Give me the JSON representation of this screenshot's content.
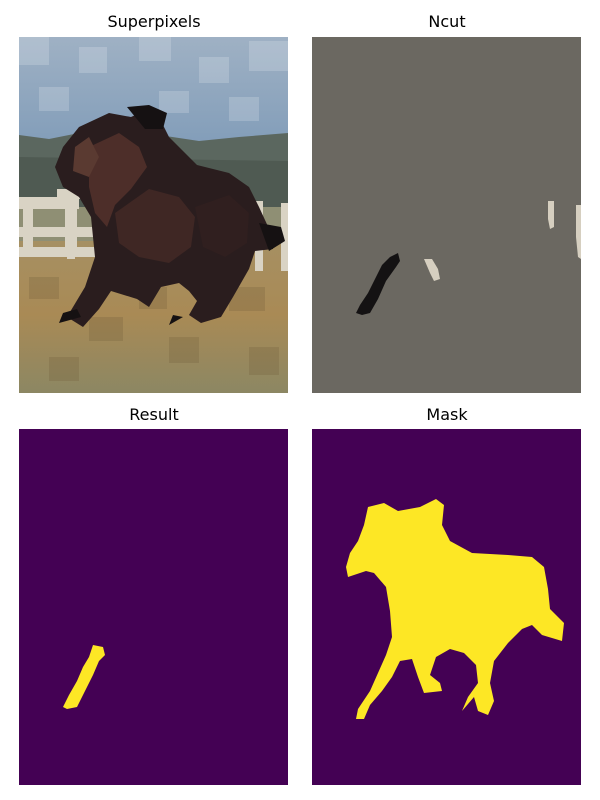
{
  "panels": [
    {
      "title": "Superpixels"
    },
    {
      "title": "Ncut"
    },
    {
      "title": "Result"
    },
    {
      "title": "Mask"
    }
  ],
  "colors": {
    "sky": "#7f9bb5",
    "treeline": "#55625a",
    "fence": "#d8d2c3",
    "field": "#a58a58",
    "horse_dark": "#231a1b",
    "horse_brown": "#4a2b27",
    "ncut_background": "#6b6861",
    "ncut_leg": "#141213",
    "ncut_fence": "#d6cfc0",
    "mask_background": "#440154",
    "mask_foreground": "#fde725"
  }
}
